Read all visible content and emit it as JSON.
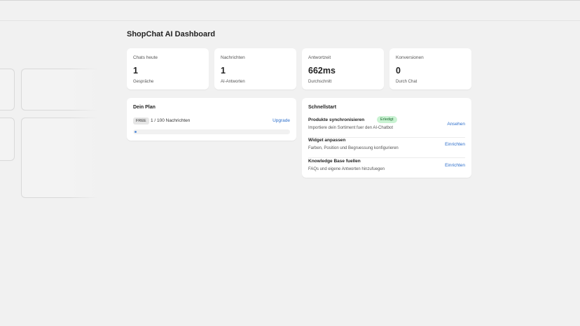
{
  "page": {
    "title": "ShopChat AI Dashboard"
  },
  "stats": [
    {
      "label": "Chats heute",
      "value": "1",
      "sub": "Gespräche"
    },
    {
      "label": "Nachrichten",
      "value": "1",
      "sub": "AI-Antworten"
    },
    {
      "label": "Antwortzeit",
      "value": "662ms",
      "sub": "Durchschnitt"
    },
    {
      "label": "Konversionen",
      "value": "0",
      "sub": "Durch Chat"
    }
  ],
  "plan": {
    "title": "Dein Plan",
    "badge": "FREE",
    "usage": "1 / 100 Nachrichten",
    "upgrade_label": "Upgrade",
    "progress_fraction": 0.01,
    "progress_color": "#5a8fd8"
  },
  "quickstart": {
    "title": "Schnellstart",
    "tasks": [
      {
        "name": "Produkte synchronisieren",
        "badge": "Erledigt",
        "desc": "Importiere dein Sortiment fuer den AI-Chatbot",
        "action": "Ansehen"
      },
      {
        "name": "Widget anpassen",
        "desc": "Farben, Position und Begruessung konfigurieren",
        "action": "Einrichten"
      },
      {
        "name": "Knowledge Base fuellen",
        "desc": "FAQs und eigene Antworten hinzufuegen",
        "action": "Einrichten"
      }
    ]
  },
  "colors": {
    "link": "#2c6ecb",
    "success_bg": "#c9f2d2",
    "success_text": "#1d6b33"
  }
}
